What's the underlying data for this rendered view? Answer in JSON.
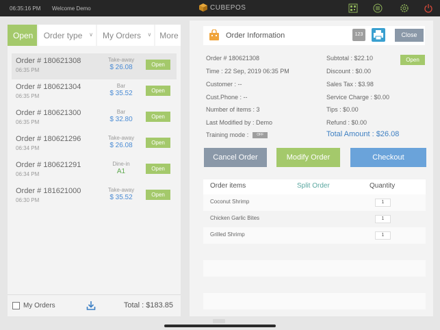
{
  "topbar": {
    "time": "06:35:16 PM",
    "welcome": "Welcome Demo",
    "brand": "CUBEPOS",
    "icons": [
      "qr-code-icon",
      "list-icon",
      "gear-icon",
      "power-icon"
    ]
  },
  "filters": {
    "open": "Open",
    "order_type": "Order type",
    "my_orders": "My Orders",
    "more": "More"
  },
  "orders": [
    {
      "number": "Order # 180621308",
      "time": "06:35 PM",
      "type": "Take-away",
      "amount": "$ 26.08",
      "status": "Open"
    },
    {
      "number": "Order # 180621304",
      "time": "06:35 PM",
      "type": "Bar",
      "amount": "$ 35.52",
      "status": "Open"
    },
    {
      "number": "Order # 180621300",
      "time": "06:35 PM",
      "type": "Bar",
      "amount": "$ 32.80",
      "status": "Open"
    },
    {
      "number": "Order # 180621296",
      "time": "06:34 PM",
      "type": "Take-away",
      "amount": "$ 26.08",
      "status": "Open"
    },
    {
      "number": "Order # 180621291",
      "time": "06:34 PM",
      "type": "Dine-in",
      "amount": "A1",
      "status": "Open"
    },
    {
      "number": "Order # 181621000",
      "time": "06:30 PM",
      "type": "Take-away",
      "amount": "$ 35.52",
      "status": "Open"
    }
  ],
  "left_footer": {
    "my_orders_label": "My Orders",
    "total": "Total : $183.85"
  },
  "info": {
    "title": "Order Information",
    "btn_123": "123",
    "close": "Close",
    "status": "Open",
    "order_no": "Order # 180621308",
    "time": "Time : 22 Sep, 2019 06:35 PM",
    "customer": "Customer : --",
    "phone": "Cust.Phone : --",
    "num_items": "Number of items : 3",
    "last_modified": "Last Modified by : Demo",
    "training_mode": "Training mode :",
    "training_toggle": "OFF",
    "subtotal": "Subtotal : $22.10",
    "discount": "Discount : $0.00",
    "sales_tax": "Sales Tax : $3.98",
    "service_charge": "Service Charge : $0.00",
    "tips": "Tips : $0.00",
    "refund": "Refund : $0.00",
    "total_amount": "Total Amount : $26.08"
  },
  "actions": {
    "cancel": "Cancel Order",
    "modify": "Modify Order",
    "checkout": "Checkout"
  },
  "items_table": {
    "col_items": "Order items",
    "col_split": "Split Order",
    "col_qty": "Quantity",
    "rows": [
      {
        "name": "Coconut Shrimp",
        "qty": "1"
      },
      {
        "name": "Chicken Garlic Bites",
        "qty": "1"
      },
      {
        "name": "Grilled Shrimp",
        "qty": "1"
      }
    ]
  },
  "colors": {
    "green": "#a4c96b",
    "gray_button": "#8a98a8",
    "blue_button": "#6aa3da",
    "amount_blue": "#4a8bd4",
    "topbar": "#262626"
  }
}
